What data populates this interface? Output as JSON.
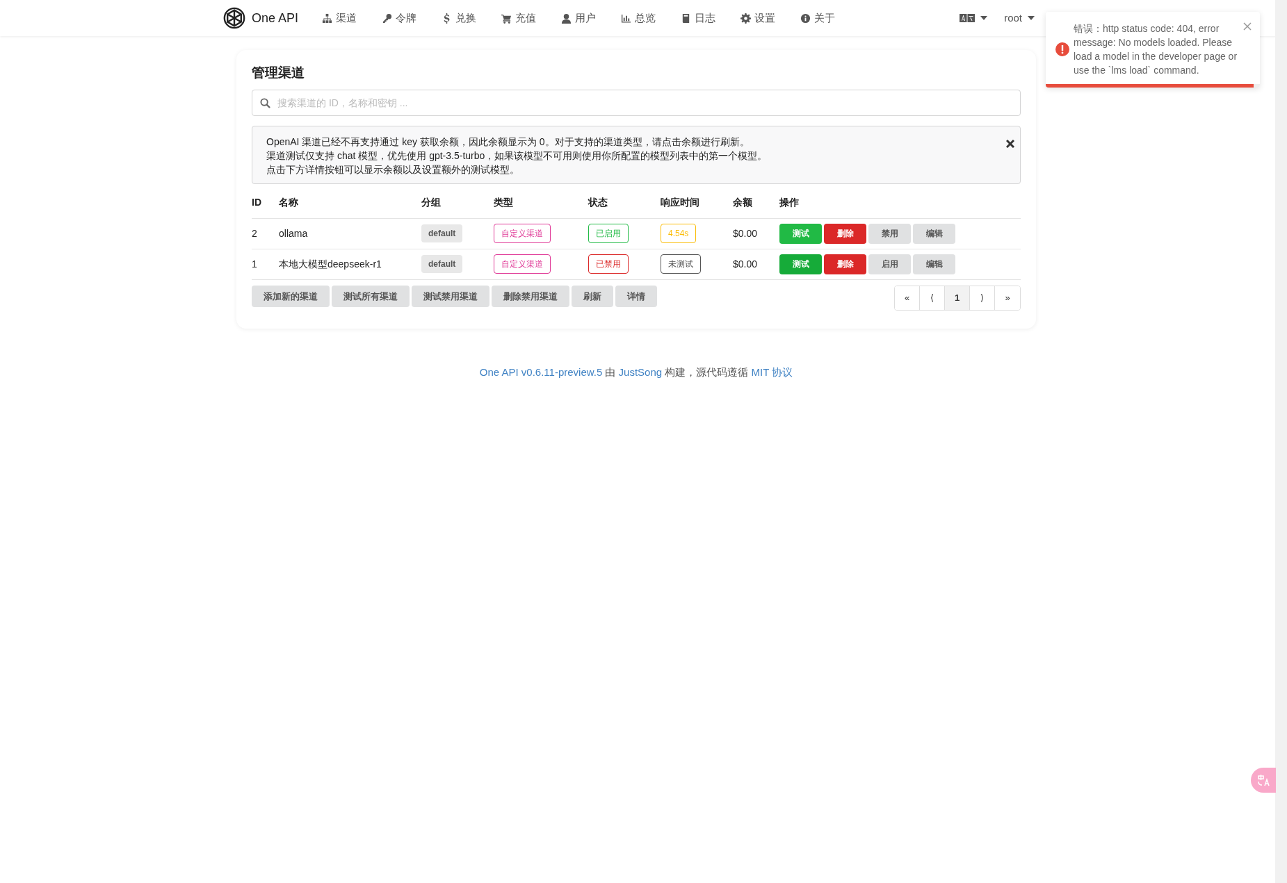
{
  "navbar": {
    "brand": "One API",
    "items": [
      {
        "kind": "sitemap",
        "label": "渠道"
      },
      {
        "kind": "key",
        "label": "令牌"
      },
      {
        "kind": "dollar",
        "label": "兑换"
      },
      {
        "kind": "cart",
        "label": "充值"
      },
      {
        "kind": "user",
        "label": "用户"
      },
      {
        "kind": "chart",
        "label": "总览"
      },
      {
        "kind": "book",
        "label": "日志"
      },
      {
        "kind": "gear",
        "label": "设置"
      },
      {
        "kind": "info",
        "label": "关于"
      }
    ],
    "user": "root"
  },
  "toast": {
    "message": "错误：http status code: 404, error message: No models loaded. Please load a model in the developer page or use the `lms load` command.",
    "level": 0.97
  },
  "page": {
    "title": "管理渠道",
    "search": {
      "placeholder": "搜索渠道的 ID，名称和密钥 ..."
    },
    "notice": [
      "OpenAI 渠道已经不再支持通过 key 获取余额，因此余额显示为 0。对于支持的渠道类型，请点击余额进行刷新。",
      "渠道测试仅支持 chat 模型，优先使用 gpt-3.5-turbo，如果该模型不可用则使用你所配置的模型列表中的第一个模型。",
      "点击下方详情按钮可以显示余额以及设置额外的测试模型。"
    ],
    "table": {
      "columns": [
        "ID",
        "名称",
        "分组",
        "类型",
        "状态",
        "响应时间",
        "余额",
        "操作"
      ],
      "rows": [
        {
          "id": "2",
          "name": "ollama",
          "group": "default",
          "type": "自定义渠道",
          "status": {
            "text": "已启用",
            "kind": "enabled"
          },
          "response": {
            "text": "4.54s",
            "kind": "slow"
          },
          "balance": "$0.00",
          "actions": [
            {
              "label": "测试",
              "kind": "test",
              "hover": false
            },
            {
              "label": "删除",
              "kind": "delete",
              "hover": false
            },
            {
              "label": "禁用",
              "kind": "plain",
              "hover": false
            },
            {
              "label": "编辑",
              "kind": "plain",
              "hover": false
            }
          ]
        },
        {
          "id": "1",
          "name": "本地大模型deepseek-r1",
          "group": "default",
          "type": "自定义渠道",
          "status": {
            "text": "已禁用",
            "kind": "disabled"
          },
          "response": {
            "text": "未测试",
            "kind": "untested"
          },
          "balance": "$0.00",
          "actions": [
            {
              "label": "测试",
              "kind": "test",
              "hover": true
            },
            {
              "label": "删除",
              "kind": "delete",
              "hover": false
            },
            {
              "label": "启用",
              "kind": "plain",
              "hover": false
            },
            {
              "label": "编辑",
              "kind": "plain",
              "hover": false
            }
          ]
        }
      ]
    },
    "buttons": [
      "添加新的渠道",
      "测试所有渠道",
      "测试禁用渠道",
      "删除禁用渠道",
      "刷新",
      "详情"
    ],
    "pagination": [
      {
        "label": "«",
        "selected": false
      },
      {
        "label": "⟨",
        "selected": false
      },
      {
        "label": "1",
        "selected": true
      },
      {
        "label": "⟩",
        "selected": false
      },
      {
        "label": "»",
        "selected": false
      }
    ]
  },
  "footer": [
    {
      "text": "One API v0.6.11-preview.5",
      "link": true
    },
    {
      "text": "由",
      "link": false
    },
    {
      "text": "JustSong",
      "link": true
    },
    {
      "text": "构建，源代码遵循",
      "link": false
    },
    {
      "text": "MIT 协议",
      "link": true
    }
  ]
}
